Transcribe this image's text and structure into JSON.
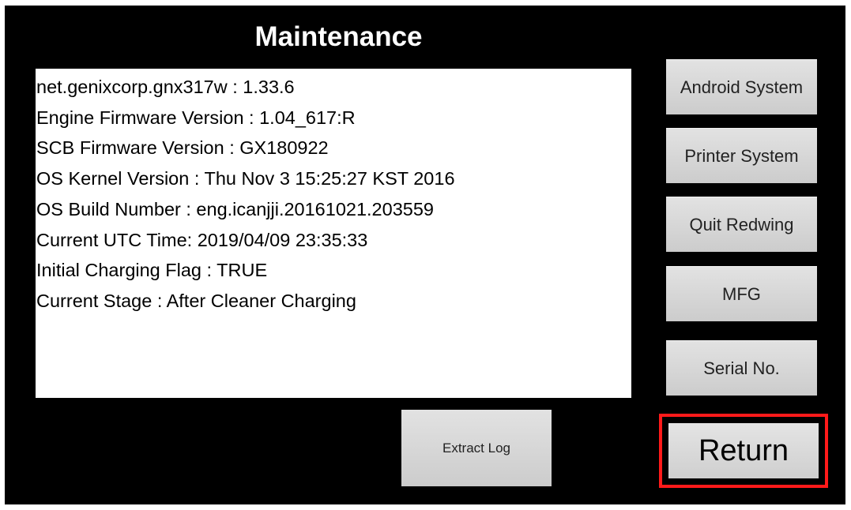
{
  "screen": {
    "title": "Maintenance"
  },
  "info": {
    "lines": [
      "net.genixcorp.gnx317w : 1.33.6",
      "Engine Firmware Version : 1.04_617:R",
      "SCB Firmware Version : GX180922",
      "OS Kernel Version : Thu Nov 3 15:25:27 KST 2016",
      "OS Build Number : eng.icanjji.20161021.203559",
      "Current UTC Time: 2019/04/09 23:35:33",
      "Initial Charging Flag : TRUE",
      "Current Stage : After Cleaner Charging"
    ]
  },
  "buttons": {
    "android_system": "Android System",
    "printer_system": "Printer System",
    "quit_redwing": "Quit Redwing",
    "mfg": "MFG",
    "serial_no": "Serial No.",
    "extract_log": "Extract Log",
    "return": "Return"
  },
  "colors": {
    "background": "#000000",
    "panel": "#ffffff",
    "button": "#d9d9d9",
    "highlight": "#ff1a1a"
  }
}
